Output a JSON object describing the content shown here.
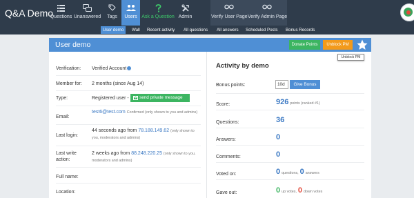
{
  "app": {
    "title": "Q&A Demo"
  },
  "nav": {
    "items": [
      {
        "label": "Questions",
        "icon": "list-icon"
      },
      {
        "label": "Unanswered",
        "icon": "chat-bubbles-icon"
      },
      {
        "label": "Tags",
        "icon": "tags-icon"
      },
      {
        "label": "Users",
        "icon": "users-icon",
        "active": true
      },
      {
        "label": "Ask a Question",
        "icon": "question-mark-icon",
        "color": "#3ec96a"
      },
      {
        "label": "Admin",
        "icon": "wrench-icon"
      }
    ],
    "plugins": [
      {
        "label": "Verify User Page",
        "icon": "infinity-icon"
      },
      {
        "label": "Verify Admin Page",
        "icon": "infinity-icon"
      }
    ]
  },
  "subnav": {
    "items": [
      {
        "label": "User demo",
        "active": true
      },
      {
        "label": "Wall"
      },
      {
        "label": "Recent activity"
      },
      {
        "label": "All questions"
      },
      {
        "label": "All answers"
      },
      {
        "label": "Scheduled Posts"
      },
      {
        "label": "Bonus Records"
      }
    ]
  },
  "profile": {
    "title": "User demo",
    "donate_label": "Donate Points",
    "unblock_label": "Unblock PM",
    "tooltip": "Unblock PM",
    "fields": {
      "verification_label": "Verification:",
      "verification_value": "Verified Account",
      "member_label": "Member for:",
      "member_value": "2 months (since Aug 14)",
      "type_label": "Type:",
      "type_value": "Registered user -",
      "send_pm_label": "send private message",
      "email_label": "Email:",
      "email_value": "test6@test.com",
      "email_note": "Confirmed (only shown to you and admins)",
      "last_login_label": "Last login:",
      "last_login_prefix": "44 seconds ago from",
      "last_login_ip": "78.188.149.62",
      "last_login_note": "(only shown to you, moderators and admins)",
      "last_write_label_1": "Last write",
      "last_write_label_2": "action:",
      "last_write_prefix": "2 weeks ago from",
      "last_write_ip": "88.248.220.25",
      "last_write_note": "(only shown to you, moderators and admins)",
      "fullname_label": "Full name:",
      "location_label": "Location:"
    }
  },
  "activity": {
    "title": "Activity by demo",
    "bonus_label": "Bonus points:",
    "bonus_input": "10d",
    "give_bonus_label": "Give Bonus",
    "score_label": "Score:",
    "score_value": "926",
    "score_note": "points (ranked #1)",
    "questions_label": "Questions:",
    "questions_value": "36",
    "answers_label": "Answers:",
    "answers_value": "0",
    "comments_label": "Comments:",
    "comments_value": "0",
    "voted_label": "Voted on:",
    "voted_questions": "0",
    "voted_questions_word": "questions,",
    "voted_answers": "0",
    "voted_answers_word": "answers",
    "gave_label": "Gave out:",
    "gave_up": "0",
    "gave_up_word": "up votes,",
    "gave_down": "0",
    "gave_down_word": "down votes"
  },
  "colors": {
    "nav_bg": "#2f3c4b",
    "accent": "#4f8fd5",
    "green": "#3cb561",
    "orange": "#f39a1b",
    "red": "#e24b3b"
  }
}
